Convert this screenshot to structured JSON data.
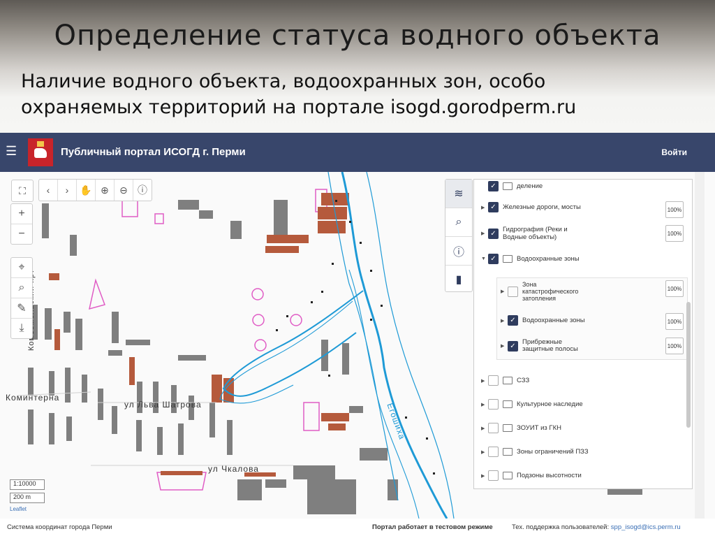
{
  "slide": {
    "title": "Определение статуса водного объекта",
    "subtitle_line1": "Наличие водного объекта, водоохранных зон, особо",
    "subtitle_line2": "охраняемых территорий на портале isogd.gorodperm.ru"
  },
  "header": {
    "portal_title": "Публичный портал ИСОГД г. Перми",
    "login_label": "Войти",
    "menu_icon": "hamburger-icon"
  },
  "map": {
    "street_labels": [
      "Комсомольский прт",
      "Коминтерна",
      "ул Льва Шатрова",
      "ул Чкалова",
      "Егошиха"
    ],
    "scale_ratio": "1:10000",
    "scale_distance": "200 m",
    "attribution": "Leaflet"
  },
  "layers": [
    {
      "label": "деление",
      "checked": true,
      "folder": true
    },
    {
      "label": "Железные дороги, мосты",
      "checked": true,
      "opacity": "100%"
    },
    {
      "label_lines": [
        "Гидрография (Реки и",
        "Водные объекты)"
      ],
      "checked": true,
      "opacity": "100%"
    },
    {
      "label": "Водоохранные зоны",
      "checked": true,
      "folder": true,
      "expanded": true,
      "children": [
        {
          "label_lines": [
            "Зона",
            "катастрофического",
            "затопления"
          ],
          "checked": false,
          "opacity": "100%"
        },
        {
          "label": "Водоохранные зоны",
          "checked": true,
          "opacity": "100%"
        },
        {
          "label_lines": [
            "Прибрежные",
            "защитные полосы"
          ],
          "checked": true,
          "opacity": "100%"
        }
      ]
    },
    {
      "label": "СЗЗ",
      "checked": false,
      "folder": true
    },
    {
      "label": "Культурное наследие",
      "checked": false,
      "folder": true
    },
    {
      "label": "ЗОУИТ из ГКН",
      "checked": false,
      "folder": true
    },
    {
      "label": "Зоны ограничений ПЗЗ",
      "checked": false,
      "folder": true
    },
    {
      "label": "Подзоны высотности",
      "checked": false,
      "folder": true
    }
  ],
  "footer": {
    "coord_system": "Система координат города Перми",
    "test_mode": "Портал работает в тестовом режиме",
    "support_label": "Тех. поддержка пользователей:",
    "support_email": "spp_isogd@ics.perm.ru"
  },
  "colors": {
    "header_bg": "#38466b",
    "river": "#1e9ad6",
    "zone": "#e05cc5",
    "building": "#7f7f7f",
    "building_highlight": "#b55a3c"
  }
}
